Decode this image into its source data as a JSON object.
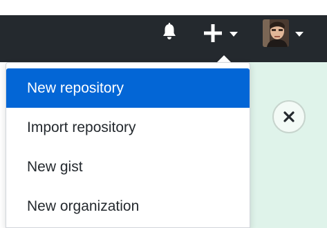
{
  "header": {
    "icons": {
      "bell": "bell-icon",
      "plus": "plus-icon",
      "plus_caret": "caret-down-icon",
      "avatar_caret": "caret-down-icon"
    }
  },
  "menu": {
    "items": [
      {
        "label": "New repository",
        "active": true
      },
      {
        "label": "Import repository",
        "active": false
      },
      {
        "label": "New gist",
        "active": false
      },
      {
        "label": "New organization",
        "active": false
      }
    ]
  },
  "colors": {
    "header_bg": "#24292e",
    "accent": "#0366d6",
    "panel_bg": "#dff3ea",
    "text": "#24292e",
    "icon": "#ffffff"
  },
  "close_icon": "close-icon"
}
